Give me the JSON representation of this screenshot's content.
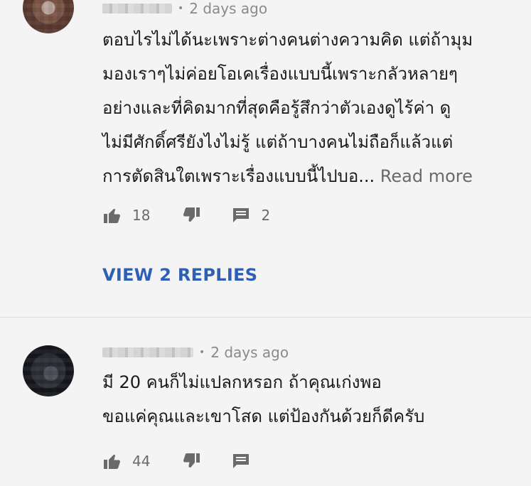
{
  "comments": [
    {
      "timestamp": "2 days ago",
      "text": "ตอบไรไม่ได้นะเพราะต่างคนต่างความคิด แต่ถ้ามุม\nมองเราๆไม่ค่อยโอเคเรื่องแบบนี้เพราะกลัวหลายๆ\nอย่างและที่คิดมากที่สุดคือรู้สึกว่าตัวเองดูไร้ค่า ดู\nไม่มีศักดิ์ศรียังไงไม่รู้ แต่ถ้าบางคนไม่ถือก็แล้วแต่\nการตัดสินใตเพราะเรื่องแบบนี้ไปบอ...",
      "read_more": "Read more",
      "likes": "18",
      "replies_count": "2",
      "view_replies": "VIEW 2 REPLIES"
    },
    {
      "timestamp": "2 days ago",
      "text": "มี 20 คนก็ไม่แปลกหรอก ถ้าคุณเก่งพอ\nขอแค่คุณและเขาโสด แต่ป้องกันด้วยก็ดีครับ",
      "likes": "44"
    }
  ],
  "icons": {
    "like": "thumbs-up-icon",
    "dislike": "thumbs-down-icon",
    "reply": "comment-icon"
  },
  "colors": {
    "background": "#f4f4f4",
    "link": "#2f5fb3",
    "muted": "#6a6a6a"
  }
}
